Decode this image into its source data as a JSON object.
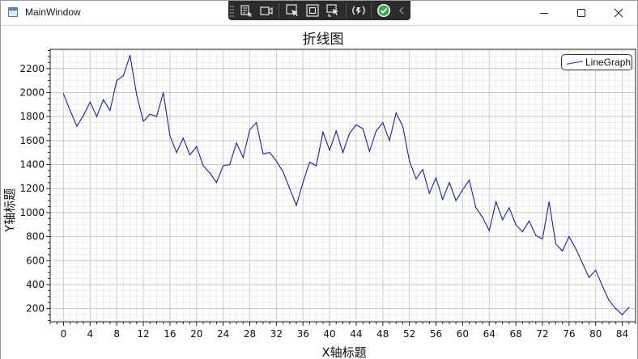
{
  "window": {
    "title": "MainWindow"
  },
  "toolbar": {
    "icons": [
      "live-visual-tree-icon",
      "select-element-icon",
      "video-icon",
      "track-focus-icon",
      "display-layout-adorners-icon",
      "preview-selection-icon",
      "hot-reload-icon",
      "binding-failures-icon",
      "collapse-icon"
    ]
  },
  "chart_data": {
    "type": "line",
    "title": "折线图",
    "xlabel": "X轴标题",
    "ylabel": "Y轴标题",
    "xlim": [
      -2,
      86
    ],
    "ylim": [
      90,
      2360
    ],
    "xticks": [
      0,
      4,
      8,
      12,
      16,
      20,
      24,
      28,
      32,
      36,
      40,
      44,
      48,
      52,
      56,
      60,
      64,
      68,
      72,
      76,
      80,
      84
    ],
    "xtick_labels": [
      "0",
      "4",
      "8",
      "12",
      "16",
      "20",
      "24",
      "28",
      "32",
      "36",
      "40",
      "44",
      "48",
      "52",
      "56",
      "60",
      "64",
      "68",
      "72",
      "76",
      "80",
      "84"
    ],
    "yticks": [
      200,
      400,
      600,
      800,
      1000,
      1200,
      1400,
      1600,
      1800,
      2000,
      2200
    ],
    "ytick_labels": [
      "200",
      "400",
      "600",
      "800",
      "1000",
      "1200",
      "1400",
      "1600",
      "1800",
      "2000",
      "2200"
    ],
    "grid": true,
    "legend": "top-right",
    "series": [
      {
        "name": "LineGraph",
        "color": "#1f1f9a",
        "x": [
          0,
          1,
          2,
          3,
          4,
          5,
          6,
          7,
          8,
          9,
          10,
          11,
          12,
          13,
          14,
          15,
          16,
          17,
          18,
          19,
          20,
          21,
          22,
          23,
          24,
          25,
          26,
          27,
          28,
          29,
          30,
          31,
          32,
          33,
          34,
          35,
          36,
          37,
          38,
          39,
          40,
          41,
          42,
          43,
          44,
          45,
          46,
          47,
          48,
          49,
          50,
          51,
          52,
          53,
          54,
          55,
          56,
          57,
          58,
          59,
          60,
          61,
          62,
          63,
          64,
          65,
          66,
          67,
          68,
          69,
          70,
          71,
          72,
          73,
          74,
          75,
          76,
          77,
          78,
          79,
          80,
          81,
          82,
          83,
          84,
          85
        ],
        "values": [
          1990,
          1850,
          1720,
          1810,
          1920,
          1800,
          1940,
          1850,
          2100,
          2140,
          2310,
          1980,
          1760,
          1820,
          1800,
          2000,
          1640,
          1500,
          1620,
          1480,
          1550,
          1390,
          1330,
          1250,
          1390,
          1400,
          1580,
          1460,
          1690,
          1750,
          1490,
          1500,
          1430,
          1340,
          1200,
          1060,
          1250,
          1420,
          1390,
          1670,
          1520,
          1680,
          1500,
          1660,
          1730,
          1700,
          1510,
          1680,
          1750,
          1600,
          1830,
          1720,
          1430,
          1280,
          1360,
          1160,
          1290,
          1110,
          1250,
          1100,
          1190,
          1270,
          1040,
          960,
          850,
          1090,
          940,
          1040,
          900,
          840,
          930,
          810,
          780,
          1090,
          740,
          680,
          800,
          700,
          580,
          460,
          520,
          390,
          270,
          200,
          150,
          210
        ]
      }
    ]
  }
}
